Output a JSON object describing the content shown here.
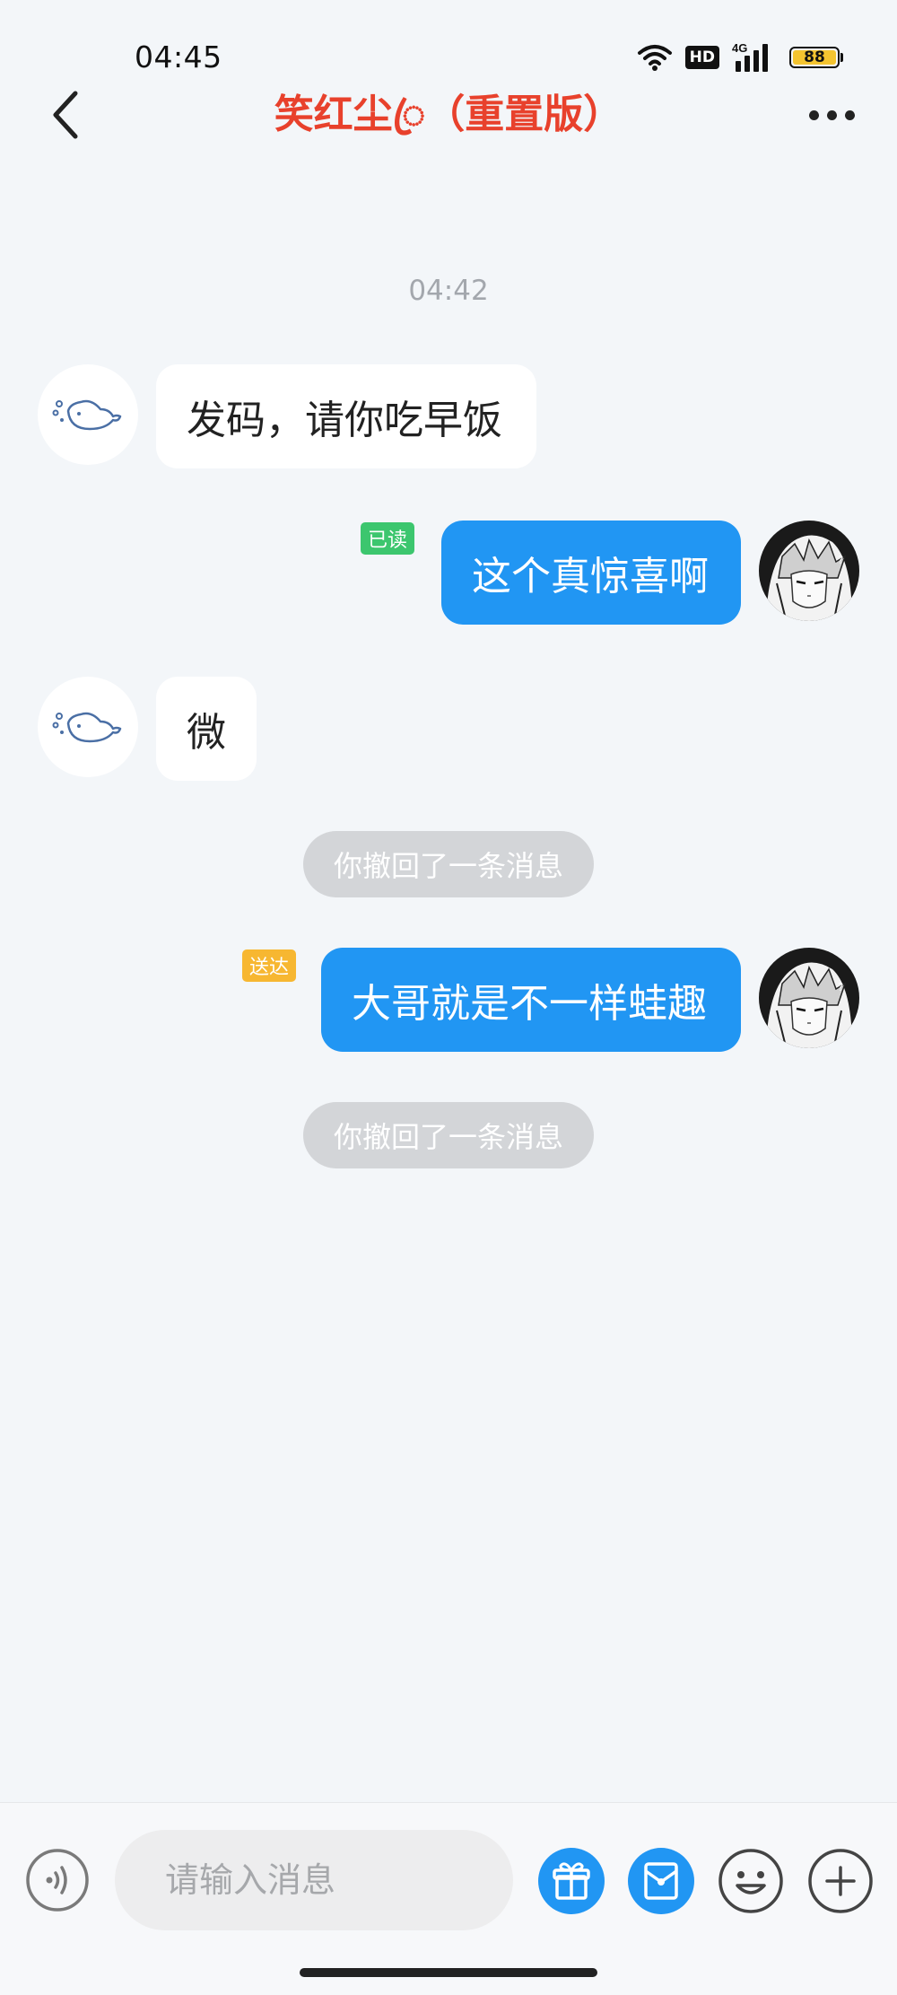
{
  "status_bar": {
    "time": "04:45",
    "network_label": "4G",
    "hd_label": "HD",
    "battery_level": "88",
    "icons": [
      "wifi-icon",
      "hd-icon",
      "signal-4g-icon",
      "battery-icon"
    ]
  },
  "header": {
    "title": "笑红尘ꦿ（重置版）",
    "back_icon": "chevron-left-icon",
    "more_icon": "more-horizontal-icon"
  },
  "conversation": {
    "timestamp": "04:42",
    "messages": [
      {
        "direction": "incoming",
        "text": "发码，请你吃早饭",
        "avatar": "whale-icon"
      },
      {
        "direction": "outgoing",
        "text": "这个真惊喜啊",
        "status": "已读",
        "avatar": "anime-avatar"
      },
      {
        "direction": "incoming",
        "text": "微",
        "avatar": "whale-icon"
      },
      {
        "type": "recall",
        "text": "你撤回了一条消息"
      },
      {
        "direction": "outgoing",
        "text": "大哥就是不一样蛙趣",
        "status": "送达",
        "avatar": "anime-avatar"
      },
      {
        "type": "recall",
        "text": "你撤回了一条消息"
      }
    ]
  },
  "input_bar": {
    "placeholder": "请输入消息",
    "buttons": [
      "voice-icon",
      "gift-icon",
      "red-packet-icon",
      "emoji-icon",
      "plus-icon"
    ]
  },
  "colors": {
    "title": "#e8412c",
    "outgoing_bubble": "#2196f3",
    "incoming_bubble": "#ffffff",
    "read_badge": "#3cc66e",
    "delivered_badge": "#f7b731",
    "background": "#f3f6f9"
  }
}
